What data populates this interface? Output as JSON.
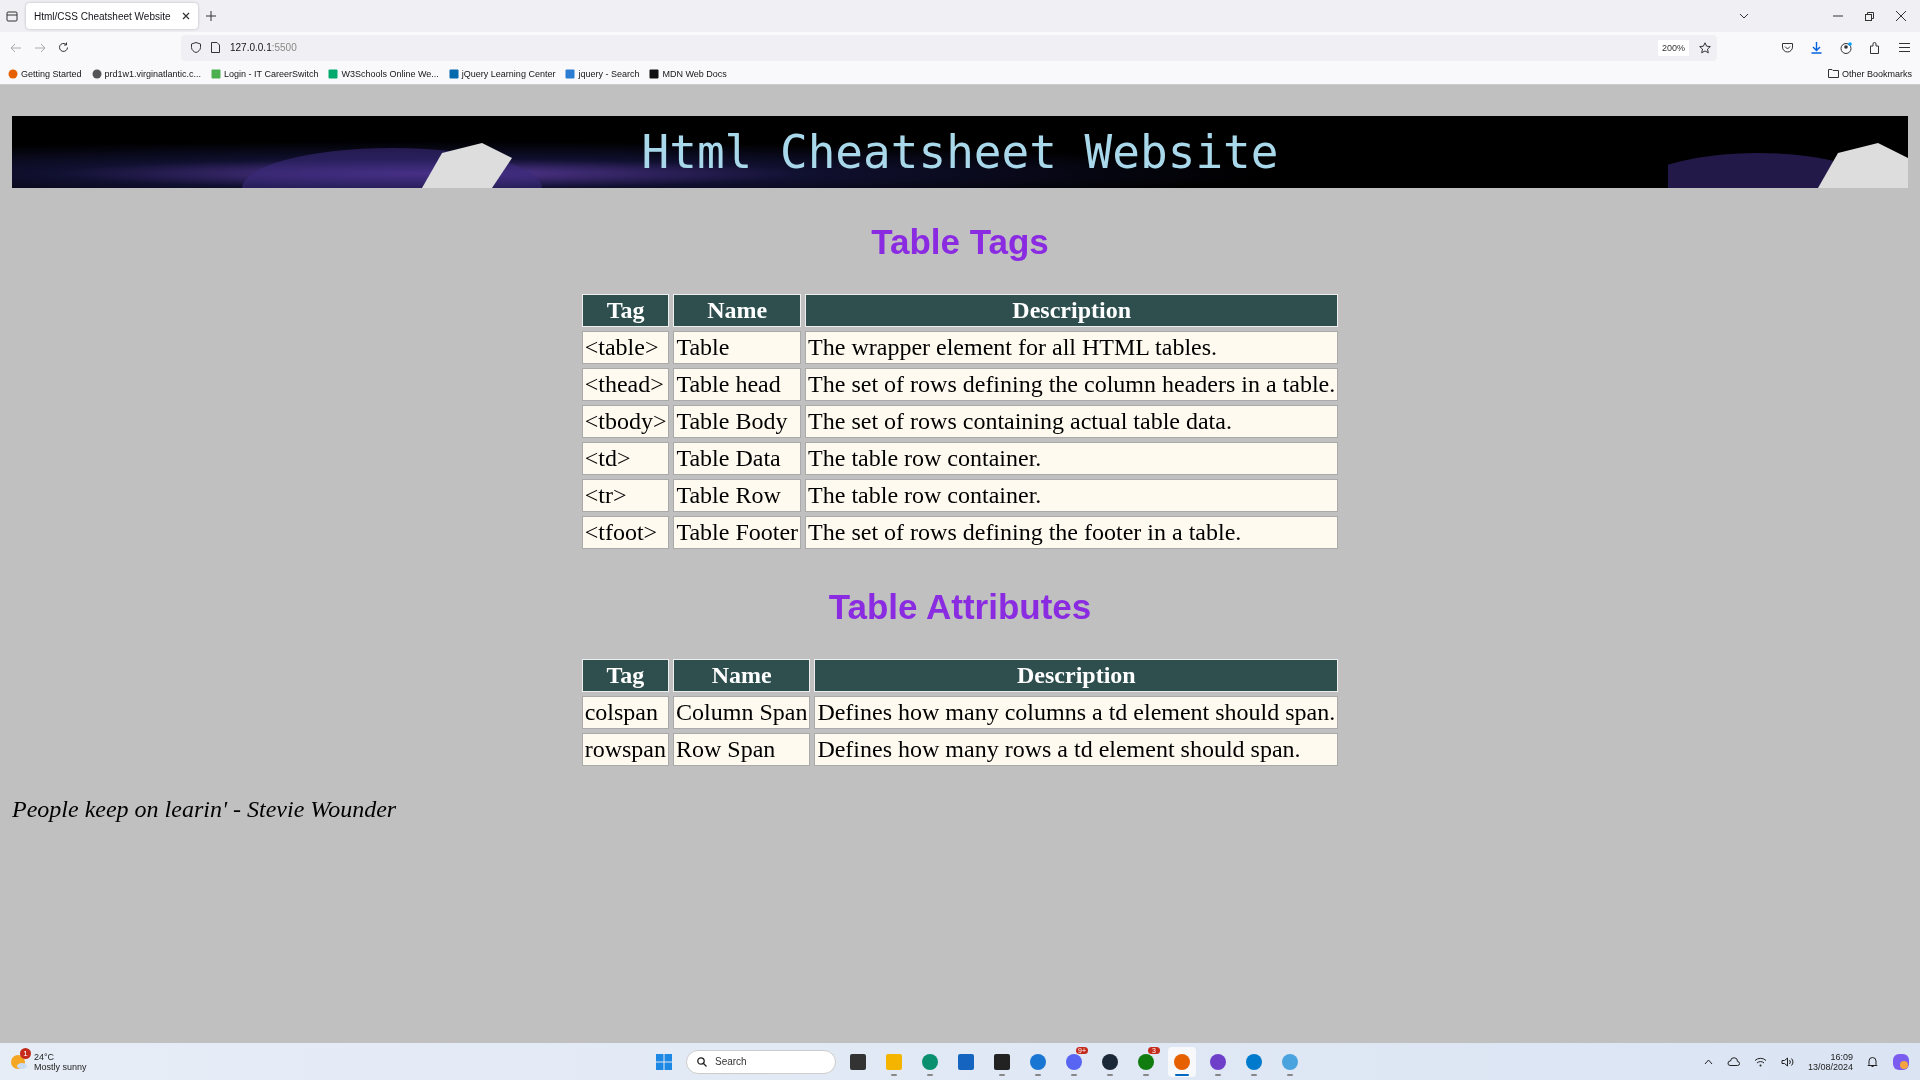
{
  "browser": {
    "tab": {
      "title": "Html/CSS Cheatsheet Website",
      "selected": true
    },
    "url_host": "127.0.0.1",
    "url_port": ":5500",
    "zoom": "200%",
    "bookmarks": [
      {
        "label": "Getting Started",
        "kind": "firefox"
      },
      {
        "label": "prd1w1.virginatlantic.c...",
        "kind": "globe"
      },
      {
        "label": "Login - IT CareerSwitch",
        "kind": "monitor"
      },
      {
        "label": "W3Schools Online We...",
        "kind": "w3"
      },
      {
        "label": "jQuery Learning Center",
        "kind": "jquery"
      },
      {
        "label": "jquery - Search",
        "kind": "bing"
      },
      {
        "label": "MDN Web Docs",
        "kind": "mdn"
      }
    ],
    "other_bookmarks": "Other Bookmarks"
  },
  "page": {
    "banner_title": "Html Cheatsheet Website",
    "sections": [
      {
        "heading": "Table Tags",
        "columns": [
          "Tag",
          "Name",
          "Description"
        ],
        "rows": [
          [
            "<table>",
            "Table",
            "The wrapper element for all HTML tables."
          ],
          [
            "<thead>",
            "Table head",
            "The set of rows defining the column headers in a table."
          ],
          [
            "<tbody>",
            "Table Body",
            "The set of rows containing actual table data."
          ],
          [
            "<td>",
            "Table Data",
            "The table row container."
          ],
          [
            "<tr>",
            "Table Row",
            "The table row container."
          ],
          [
            "<tfoot>",
            "Table Footer",
            "The set of rows defining the footer in a table."
          ]
        ]
      },
      {
        "heading": "Table Attributes",
        "columns": [
          "Tag",
          "Name",
          "Description"
        ],
        "rows": [
          [
            "colspan",
            "Column Span",
            "Defines how many columns a td element should span."
          ],
          [
            "rowspan",
            "Row Span",
            "Defines how many rows a td element should span."
          ]
        ]
      }
    ],
    "quote": "People keep on learin' - Stevie Wounder"
  },
  "taskbar": {
    "weather": {
      "temperature": "24°C",
      "condition": "Mostly sunny",
      "badge": "1"
    },
    "search_placeholder": "Search",
    "apps": [
      {
        "kind": "start",
        "running": false,
        "selected": false
      },
      {
        "kind": "taskview",
        "running": false,
        "selected": false
      },
      {
        "kind": "folder",
        "running": true,
        "selected": false
      },
      {
        "kind": "edge",
        "running": true,
        "selected": false
      },
      {
        "kind": "store",
        "running": false,
        "selected": false
      },
      {
        "kind": "notes",
        "running": true,
        "selected": false
      },
      {
        "kind": "share",
        "running": true,
        "selected": false
      },
      {
        "kind": "chat",
        "running": true,
        "selected": false,
        "badge": "9+"
      },
      {
        "kind": "steam",
        "running": true,
        "selected": false
      },
      {
        "kind": "xbox",
        "running": true,
        "selected": false,
        "badge": "3"
      },
      {
        "kind": "firefox",
        "running": true,
        "selected": true
      },
      {
        "kind": "github",
        "running": true,
        "selected": false
      },
      {
        "kind": "vscode",
        "running": true,
        "selected": false
      },
      {
        "kind": "paint",
        "running": true,
        "selected": false
      }
    ],
    "time": "16:09",
    "date": "13/08/2024"
  }
}
